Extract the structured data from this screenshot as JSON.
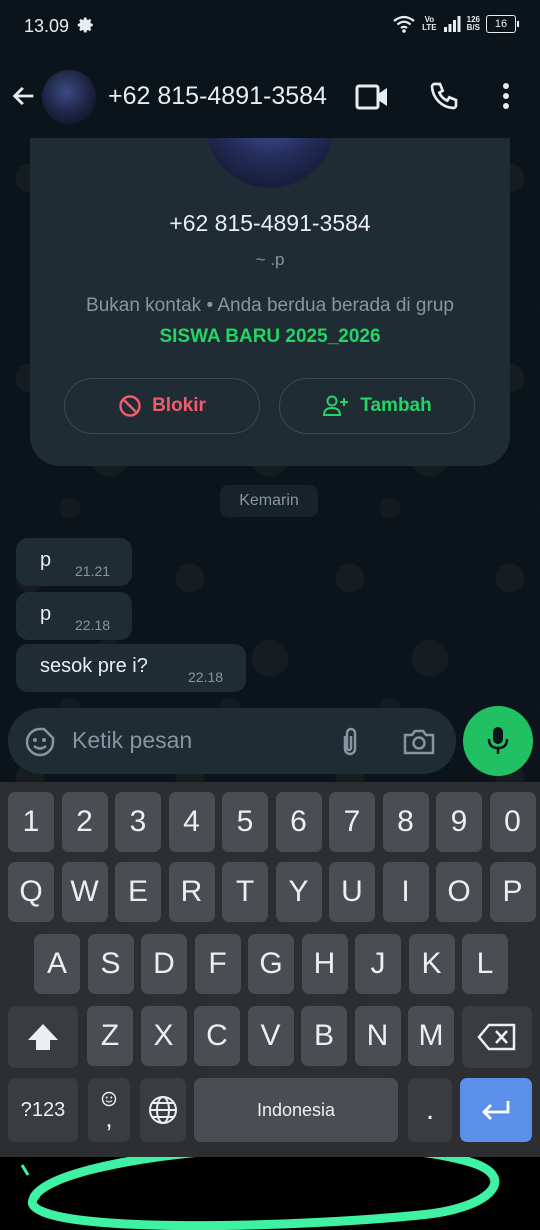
{
  "status_bar": {
    "time": "13.09",
    "network_type_top": "Vo",
    "network_type_bottom": "LTE",
    "speed_value": "126",
    "speed_unit": "B/S",
    "battery": "16"
  },
  "header": {
    "contact_name": "+62 815-4891-3584"
  },
  "info_card": {
    "phone": "+62 815-4891-3584",
    "push_name": "~ .p",
    "info_prefix": "Bukan kontak • Anda berdua berada di grup",
    "group_name": "SISWA BARU 2025_2026",
    "block_label": "Blokir",
    "add_label": "Tambah"
  },
  "date_chip": "Kemarin",
  "messages": [
    {
      "text": "p",
      "time": "21.21"
    },
    {
      "text": "p",
      "time": "22.18"
    },
    {
      "text": "sesok pre i?",
      "time": "22.18"
    }
  ],
  "composer": {
    "placeholder": "Ketik pesan"
  },
  "keyboard": {
    "row_numbers": [
      "1",
      "2",
      "3",
      "4",
      "5",
      "6",
      "7",
      "8",
      "9",
      "0"
    ],
    "row_1": [
      "Q",
      "W",
      "E",
      "R",
      "T",
      "Y",
      "U",
      "I",
      "O",
      "P"
    ],
    "row_2": [
      "A",
      "S",
      "D",
      "F",
      "G",
      "H",
      "J",
      "K",
      "L"
    ],
    "row_3": [
      "Z",
      "X",
      "C",
      "V",
      "B",
      "N",
      "M"
    ],
    "symbols_label": "?123",
    "comma_label": ",",
    "space_label": "Indonesia",
    "period_label": "."
  },
  "colors": {
    "accent_green": "#25d366",
    "block_red": "#f15c6d",
    "enter_blue": "#5b8fe8",
    "annotation_marker": "#3ff2a3"
  },
  "icons": [
    "gear-icon",
    "wifi-icon",
    "signal-icon",
    "battery-icon",
    "back-arrow-icon",
    "video-call-icon",
    "phone-icon",
    "more-vert-icon",
    "block-icon",
    "add-person-icon",
    "emoji-sticker-icon",
    "attach-icon",
    "camera-icon",
    "mic-icon",
    "shift-icon",
    "backspace-icon",
    "emoji-key-icon",
    "globe-icon",
    "enter-icon"
  ]
}
